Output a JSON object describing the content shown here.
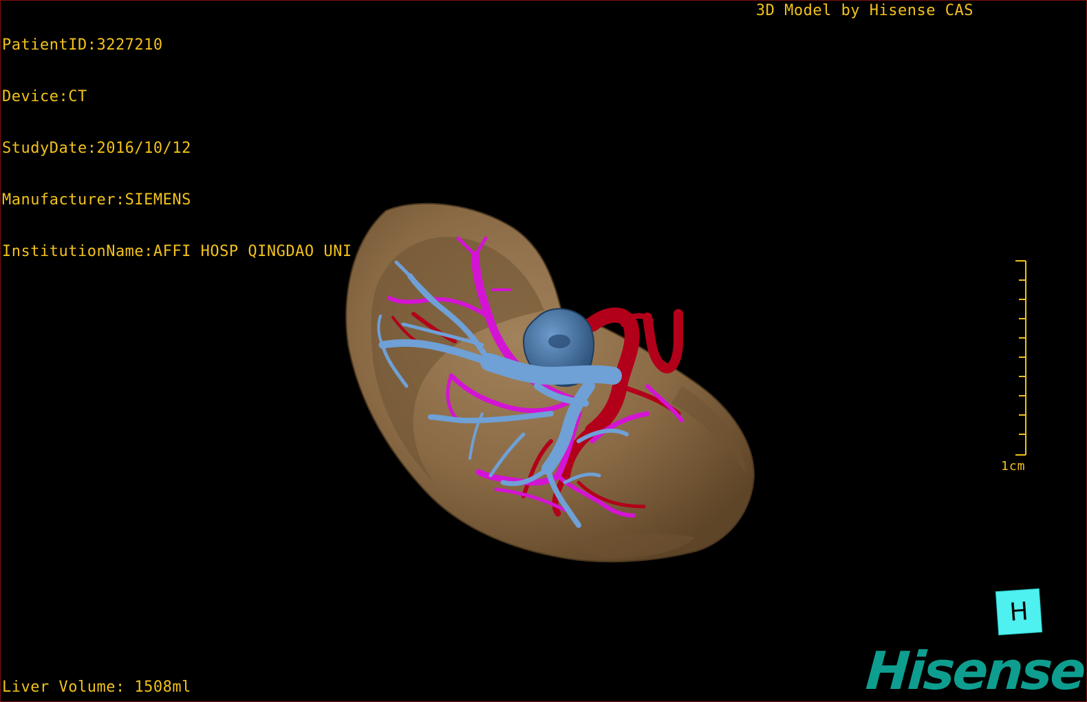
{
  "metadata": {
    "patient_id": "PatientID:3227210",
    "device": "Device:CT",
    "study_date": "StudyDate:2016/10/12",
    "manufacturer": "Manufacturer:SIEMENS",
    "institution": "InstitutionName:AFFI HOSP QINGDAO UNI"
  },
  "caption": "3D Model by Hisense CAS",
  "volume": "Liver Volume: 1508ml",
  "scale_bar": {
    "label": "1cm"
  },
  "orientation_marker": {
    "letter": "H"
  },
  "logo": {
    "text": "Hisense"
  },
  "colors": {
    "overlay_text": "#f2c21b",
    "liver": "#8a6a45",
    "portal_vein": "#6fa0d6",
    "hepatic_vein": "#d414d4",
    "artery": "#b3001a",
    "vena_cava": "#3f6f9e",
    "logo": "#0e9e90",
    "orientation_cube": "#4ff0f0"
  }
}
